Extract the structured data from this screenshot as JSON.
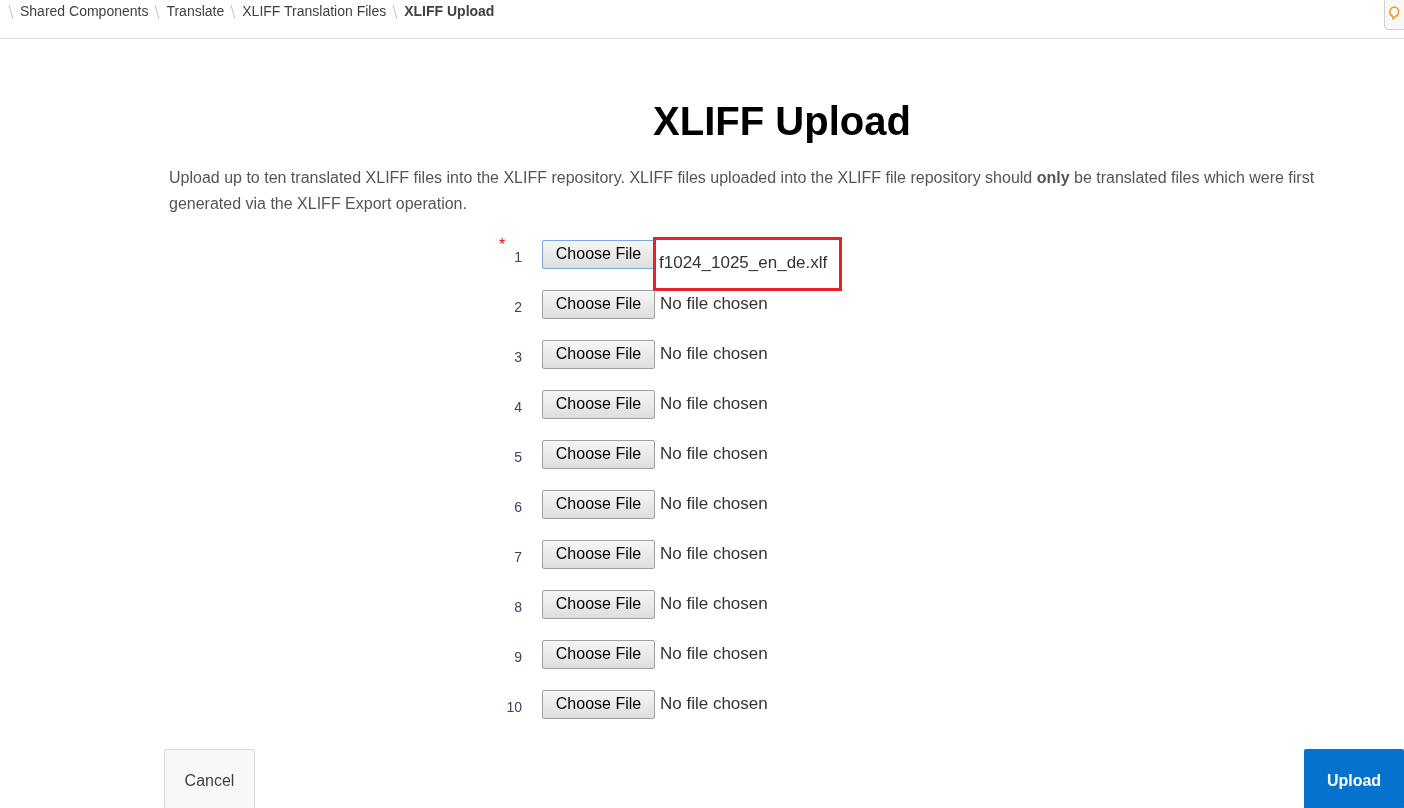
{
  "breadcrumbs": [
    {
      "label": "Shared Components",
      "selected": false
    },
    {
      "label": "Translate",
      "selected": false
    },
    {
      "label": "XLIFF Translation Files",
      "selected": false
    },
    {
      "label": "XLIFF Upload",
      "selected": true
    }
  ],
  "title": "XLIFF Upload",
  "description": "Upload up to ten translated XLIFF files into the XLIFF repository. XLIFF files uploaded into the XLIFF file repository should **only** be translated files which were first generated via the XLIFF Export operation.",
  "required_mark": "*",
  "files": [
    {
      "number": "1",
      "required": true,
      "highlighted": true,
      "button": "Choose File",
      "file": "f1024_1025_en_de.xlf"
    },
    {
      "number": "2",
      "required": false,
      "highlighted": false,
      "button": "Choose File",
      "file": "No file chosen"
    },
    {
      "number": "3",
      "required": false,
      "highlighted": false,
      "button": "Choose File",
      "file": "No file chosen"
    },
    {
      "number": "4",
      "required": false,
      "highlighted": false,
      "button": "Choose File",
      "file": "No file chosen"
    },
    {
      "number": "5",
      "required": false,
      "highlighted": false,
      "button": "Choose File",
      "file": "No file chosen"
    },
    {
      "number": "6",
      "required": false,
      "highlighted": false,
      "button": "Choose File",
      "file": "No file chosen"
    },
    {
      "number": "7",
      "required": false,
      "highlighted": false,
      "button": "Choose File",
      "file": "No file chosen"
    },
    {
      "number": "8",
      "required": false,
      "highlighted": false,
      "button": "Choose File",
      "file": "No file chosen"
    },
    {
      "number": "9",
      "required": false,
      "highlighted": false,
      "button": "Choose File",
      "file": "No file chosen"
    },
    {
      "number": "10",
      "required": false,
      "highlighted": false,
      "button": "Choose File",
      "file": "No file chosen"
    }
  ],
  "buttons": {
    "cancel": "Cancel",
    "upload": "Upload"
  }
}
